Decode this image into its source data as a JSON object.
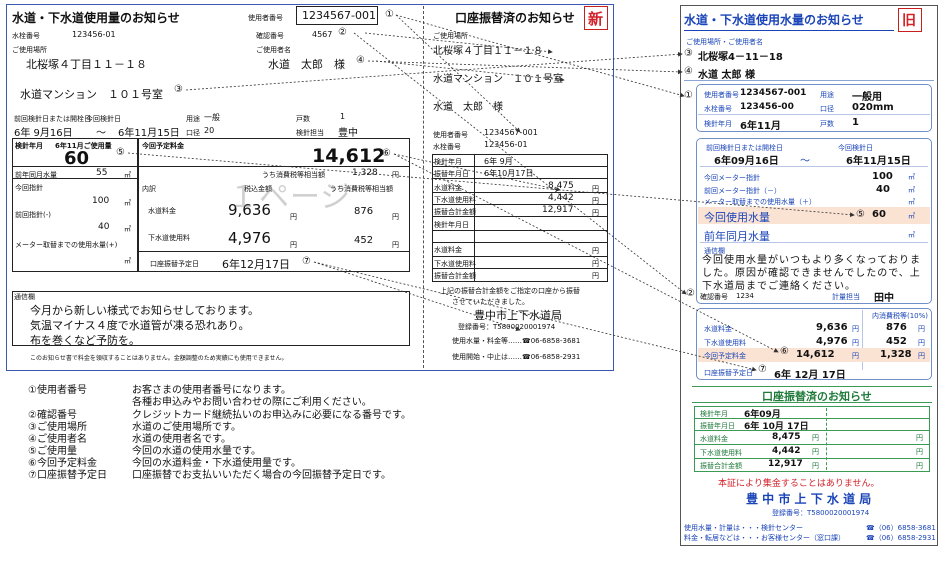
{
  "old": {
    "title": "水道・下水道使用量のお知らせ",
    "new_badge": "新",
    "user_no_label": "使用者番号",
    "user_no": "1234567-001",
    "meter_no_label": "水栓番号",
    "meter_no": "123456-01",
    "confirm_label": "確認番号",
    "confirm_no": "4567",
    "place_label": "ご使用場所",
    "place": "北桜塚４丁目１１－１８",
    "name_label": "ご使用者名",
    "name": "水道　太郎　様",
    "building": "水道マンション　１０１号室",
    "prev_date_label": "前回検針日または開栓日",
    "this_date_label": "今回検針日",
    "prev_date": "6年 9月16日",
    "tilde": "～",
    "this_date": "6年11月15日",
    "use_label": "用途",
    "use": "一般",
    "caliber_label": "口径",
    "caliber": "20",
    "households_label": "戸数",
    "households": "1",
    "inspector_label": "検針担当",
    "inspector": "豊中",
    "usage_month_label": "検針年月",
    "usage_month": "6年11月ご使用量",
    "usage": "60",
    "last_year_label": "前年同月水量",
    "last_year": "55",
    "this_meter_label": "今回指針",
    "this_meter": "100",
    "prev_meter_label": "前回指針(-)",
    "prev_meter": "40",
    "meter_change_label": "メーター取替までの使用水量(+)",
    "unit_m3": "㎥",
    "planned_label": "今回予定料金",
    "planned": "14,612",
    "breakdown_label": "内訳",
    "tax_incl_label": "税込金額",
    "tax_label": "うち消費税等相当額",
    "tax_total": "1,328",
    "water_label": "水道料金",
    "water_fee": "9,636",
    "water_tax": "876",
    "sewer_label": "下水道使用料",
    "sewer_fee": "4,976",
    "sewer_tax": "452",
    "yen": "円",
    "debit_date_label": "口座振替予定日",
    "debit_date": "6年12月17日",
    "watermark": "１ページ",
    "notice_label": "通信欄",
    "notice1": "今月から新しい様式でお知らせしております。",
    "notice2": "気温マイナス４度で水道管が凍る恐れあり。",
    "notice3": "布を巻くなど予防を。",
    "footnote": "このお知らせ書で料金を領収することはありません。金額調整のため実績にも使用できません。",
    "right_title": "口座振替済のお知らせ",
    "r_user_no_label": "使用者番号",
    "r_user_no": "1234567-001",
    "r_meter_no_label": "水栓番号",
    "r_meter_no": "123456-01",
    "r_month_label": "検針年月",
    "r_month": "6年 9月",
    "r_debit_label": "振替年月日",
    "r_debit": "6年10月17日",
    "r_water_label": "水道料金",
    "r_water": "8,475",
    "r_sewer_label": "下水道使用料",
    "r_sewer": "4,442",
    "r_total_label": "振替合計金額",
    "r_total": "12,917",
    "r2_month_label": "検針年月日",
    "r2_water_label": "水道料金",
    "r2_sewer_label": "下水道使用料",
    "r2_total_label": "振替合計金額",
    "r_note1": "上記の振替合計金額をご指定の口座から振替",
    "r_note2": "させていただきました。",
    "office": "豊中市上下水道局",
    "reg_no": "登録番号：T5800020001974",
    "contact1": "使用水量・料金等……☎06-6858-3681",
    "contact2": "使用開始・中止は……☎06-6858-2931"
  },
  "markers": {
    "m1": "①",
    "m2": "②",
    "m3": "③",
    "m4": "④",
    "m5": "⑤",
    "m6": "⑥",
    "m7": "⑦"
  },
  "legend": [
    {
      "key": "①使用者番号",
      "text": "お客さまの使用者番号になります。",
      "text2": "各種お申込みやお問い合わせの際にご利用ください。"
    },
    {
      "key": "②確認番号",
      "text": "クレジットカード継続払いのお申込みに必要になる番号です。",
      "text2": ""
    },
    {
      "key": "③ご使用場所",
      "text": "水道のご使用場所です。",
      "text2": ""
    },
    {
      "key": "④ご使用者名",
      "text": "水道の使用者名です。",
      "text2": ""
    },
    {
      "key": "⑤ご使用量",
      "text": "今回の水道の使用水量です。",
      "text2": ""
    },
    {
      "key": "⑥今回予定料金",
      "text": "今回の水道料金・下水道使用量です。",
      "text2": ""
    },
    {
      "key": "⑦口座振替予定日",
      "text": "口座振替でお支払いいただく場合の今回振替予定日です。",
      "text2": ""
    }
  ],
  "new": {
    "title": "水道・下水道使用水量のお知らせ",
    "old_badge": "旧",
    "place_name_label": "ご使用場所・ご使用者名",
    "place": "北桜塚4－11－18",
    "name": "水道 太郎 様",
    "user_no_label": "使用者番号",
    "user_no": "1234567-001",
    "meter_no_label": "水栓番号",
    "meter_no": "123456-00",
    "month_label": "検針年月",
    "month": "6年11月",
    "use_label": "用途",
    "use": "一般用",
    "caliber_label": "口径",
    "caliber": "020mm",
    "households_label": "戸数",
    "households": "1",
    "prev_date_label": "前回検針日または開栓日",
    "prev_date": "6年09月16日",
    "tilde": "～",
    "this_date_label": "今回検針日",
    "this_date": "6年11月15日",
    "this_meter_label": "今回メーター指針",
    "this_meter": "100",
    "prev_meter_label": "前回メーター指針（－）",
    "prev_meter": "40",
    "meter_change_label": "メーター取替までの使用水量（＋）",
    "usage_label": "今回使用水量",
    "usage": "60",
    "last_year_label": "前年同月水量",
    "unit": "㎥",
    "notice_label": "通信欄",
    "notice": "今回使用水量がいつもより多くなっておりました。原因が確認できませんでしたので、上下水道局までご連絡ください。",
    "confirm_label": "確認番号",
    "confirm_no": "1234",
    "inspector_label": "計量担当",
    "inspector": "田中",
    "tax_header": "内消費税等(10%)",
    "water_label": "水道料金",
    "water_fee": "9,636",
    "water_tax": "876",
    "sewer_label": "下水道使用料",
    "sewer_fee": "4,976",
    "sewer_tax": "452",
    "planned_label": "今回予定料金",
    "planned": "14,612",
    "planned_tax": "1,328",
    "yen": "円",
    "debit_date_label": "口座振替予定日",
    "debit_date": "6年 12月 17日",
    "green_title": "口座振替済のお知らせ",
    "g_month_label": "検針年月",
    "g_month": "6年09月",
    "g_debit_label": "振替年月日",
    "g_debit": "6年 10月 17日",
    "g_water_label": "水道料金",
    "g_water": "8,475",
    "g_sewer_label": "下水道使用料",
    "g_sewer": "4,442",
    "g_total_label": "振替合計金額",
    "g_total": "12,917",
    "red_note": "本証により集金することはありません。",
    "office": "豊 中 市 上 下 水 道 局",
    "reg_no": "登録番号：T5800020001974",
    "contact1_label": "使用水量・計量は・・・検針センター",
    "contact1_tel": "☎（06）6858-3681",
    "contact2_label": "料金・転居などは・・・お客様センター（窓口課）",
    "contact2_tel": "☎（06）6858-2931"
  }
}
